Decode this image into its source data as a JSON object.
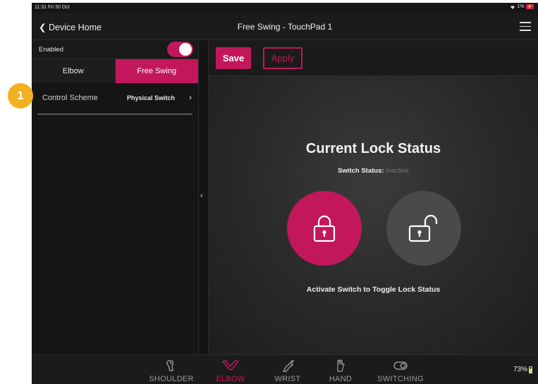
{
  "status_bar": {
    "time": "11:31  Fri 30 Oct",
    "right": "1%"
  },
  "nav": {
    "back_label": "Device Home",
    "title": "Free Swing - TouchPad 1",
    "menu_icon": "hamburger-menu-icon"
  },
  "left_panel": {
    "enabled_label": "Enabled",
    "enabled": true,
    "segments": [
      {
        "label": "Elbow",
        "active": false
      },
      {
        "label": "Free Swing",
        "active": true
      }
    ],
    "control_scheme": {
      "label": "Control Scheme",
      "value": "Physical Switch"
    }
  },
  "toolbar": {
    "save_label": "Save",
    "apply_label": "Apply"
  },
  "lock_panel": {
    "title": "Current Lock Status",
    "switch_status_label": "Switch Status:",
    "switch_status_value": "Inactive",
    "hint": "Activate Switch to Toggle Lock Status",
    "locked_icon": "padlock-locked-icon",
    "unlocked_icon": "padlock-unlocked-icon"
  },
  "tabs": [
    {
      "label": "SHOULDER",
      "icon": "shoulder-icon",
      "active": false
    },
    {
      "label": "ELBOW",
      "icon": "elbow-icon",
      "active": true
    },
    {
      "label": "WRIST",
      "icon": "wrist-icon",
      "active": false
    },
    {
      "label": "HAND",
      "icon": "hand-icon",
      "active": false
    },
    {
      "label": "SWITCHING",
      "icon": "switching-icon",
      "active": false
    }
  ],
  "battery": "73%",
  "callout": "1",
  "colors": {
    "accent": "#c2185b",
    "callout": "#f2b01e",
    "background": "#1c1c1c"
  }
}
